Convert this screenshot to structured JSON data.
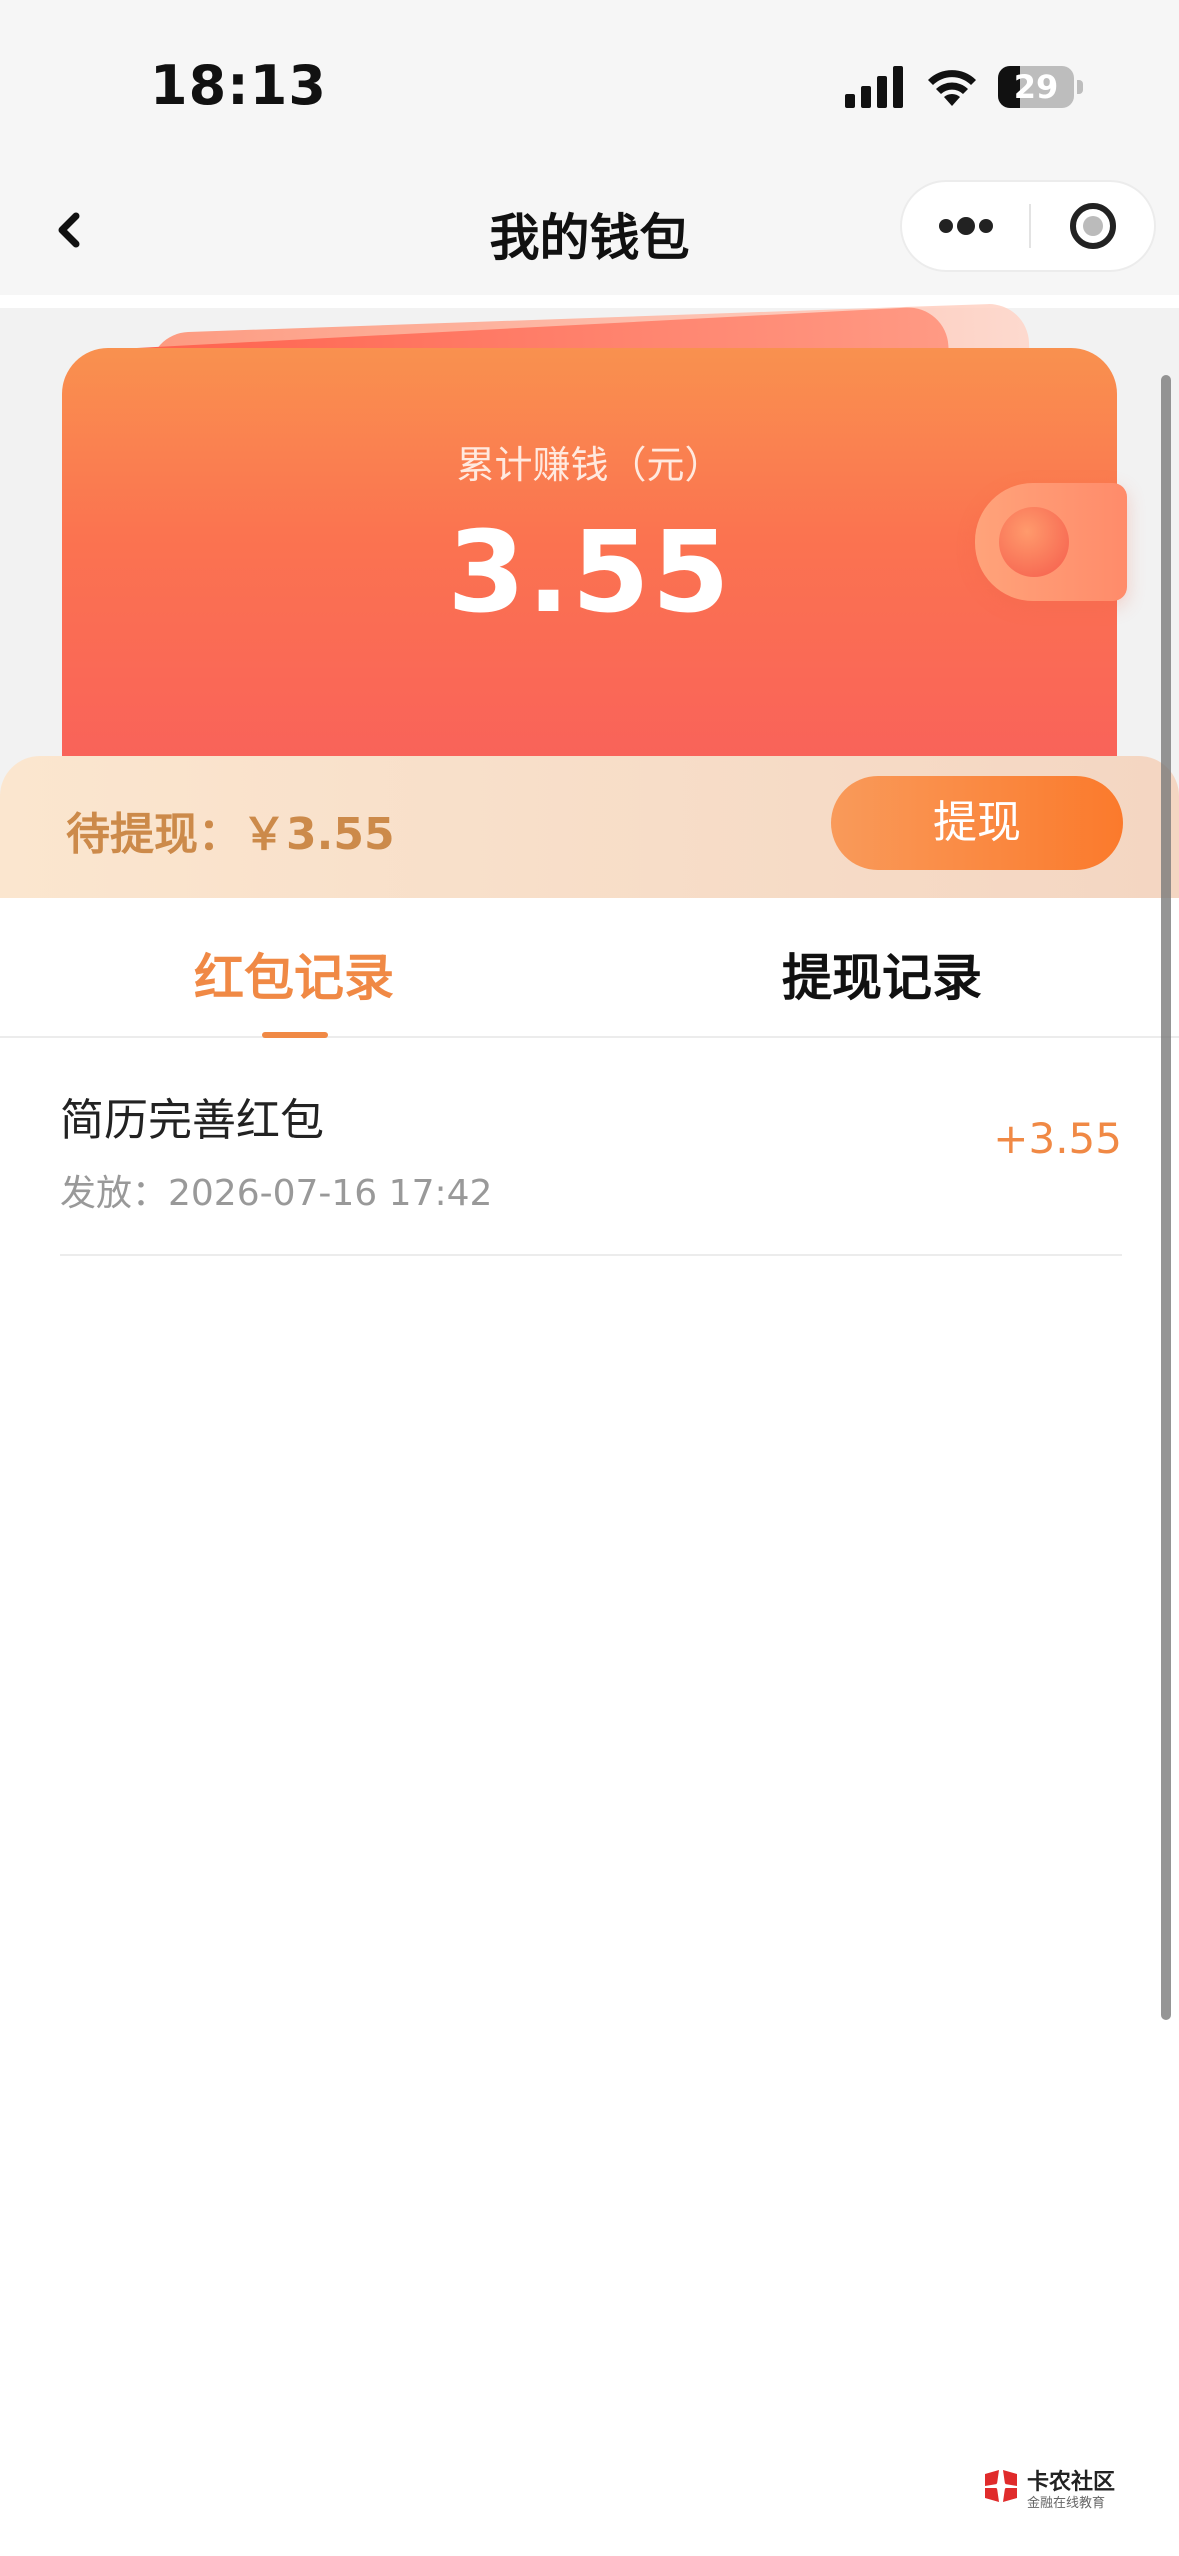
{
  "status_bar": {
    "time": "18:13",
    "battery_level": "29",
    "icons": [
      "signal-icon",
      "wifi-icon",
      "battery-icon"
    ]
  },
  "nav": {
    "title": "我的钱包",
    "back_icon": "chevron-left-icon",
    "more_icon": "more-dots-icon",
    "close_icon": "close-circle-icon"
  },
  "wallet": {
    "label": "累计赚钱（元）",
    "total": "3.55",
    "pending_text": "待提现：￥3.55",
    "withdraw_label": "提现"
  },
  "tabs": [
    {
      "label": "红包记录",
      "active": true
    },
    {
      "label": "提现记录",
      "active": false
    }
  ],
  "records": [
    {
      "title": "简历完善红包",
      "time": "发放：2026-07-16 17:42",
      "amount": "+3.55"
    }
  ],
  "watermark": {
    "title": "卡农社区",
    "subtitle": "金融在线教育"
  },
  "colors": {
    "accent": "#f08945",
    "card_top": "#f9914f",
    "card_bottom": "#f9625a"
  }
}
